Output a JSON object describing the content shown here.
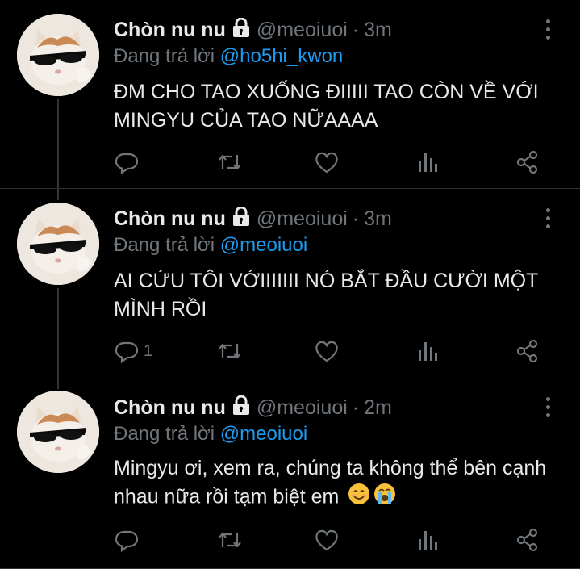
{
  "tweets": [
    {
      "name": "Chòn nu nu",
      "handle": "@meoiuoi",
      "time": "3m",
      "reply_prefix": "Đang trả lời",
      "reply_to": "@ho5hi_kwon",
      "text": "ĐM CHO TAO XUỐNG ĐIIIII TAO CÒN VỀ VỚI MINGYU CỦA TAO NỮAAAA",
      "reply_count": "",
      "emojis": []
    },
    {
      "name": "Chòn nu nu",
      "handle": "@meoiuoi",
      "time": "3m",
      "reply_prefix": "Đang trả lời",
      "reply_to": "@meoiuoi",
      "text": "AI CỨU TÔI VỚIIIIIII NÓ BẮT ĐẦU CƯỜI MỘT MÌNH RỒI",
      "reply_count": "1",
      "emojis": []
    },
    {
      "name": "Chòn nu nu",
      "handle": "@meoiuoi",
      "time": "2m",
      "reply_prefix": "Đang trả lời",
      "reply_to": "@meoiuoi",
      "text": "Mingyu ơi, xem ra, chúng ta không thể bên cạnh nhau nữa rồi tạm biệt em",
      "reply_count": "",
      "emojis": [
        "smiling-face-emoji",
        "loudly-crying-face-emoji"
      ]
    }
  ],
  "icons": {
    "lock": "lock-icon",
    "more": "more-options-icon",
    "reply": "reply-icon",
    "retweet": "retweet-icon",
    "like": "heart-icon",
    "views": "analytics-icon",
    "share": "share-icon"
  },
  "colors": {
    "background": "#000000",
    "text": "#e7e9ea",
    "muted": "#71767b",
    "mention": "#1d9bf0",
    "divider": "#2f3336"
  }
}
